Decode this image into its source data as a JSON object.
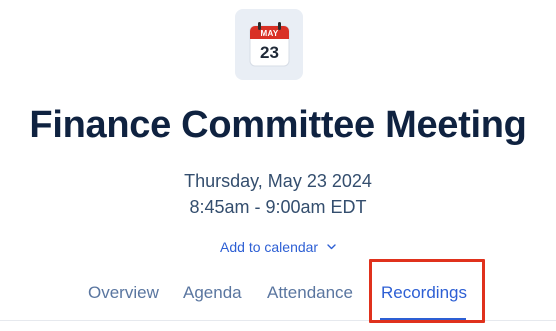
{
  "calendar_icon": {
    "month": "MAY",
    "day": "23",
    "color": "#d93025"
  },
  "meeting": {
    "title": "Finance Committee Meeting",
    "date": "Thursday, May 23 2024",
    "time": "8:45am - 9:00am EDT"
  },
  "add_to_calendar": {
    "label": "Add to calendar",
    "icon": "chevron-down-icon"
  },
  "tabs": [
    {
      "label": "Overview",
      "active": false
    },
    {
      "label": "Agenda",
      "active": false
    },
    {
      "label": "Attendance",
      "active": false
    },
    {
      "label": "Recordings",
      "active": true
    }
  ],
  "colors": {
    "accent": "#2d5fd4",
    "title": "#0f2240",
    "annotation": "#e0311c"
  }
}
